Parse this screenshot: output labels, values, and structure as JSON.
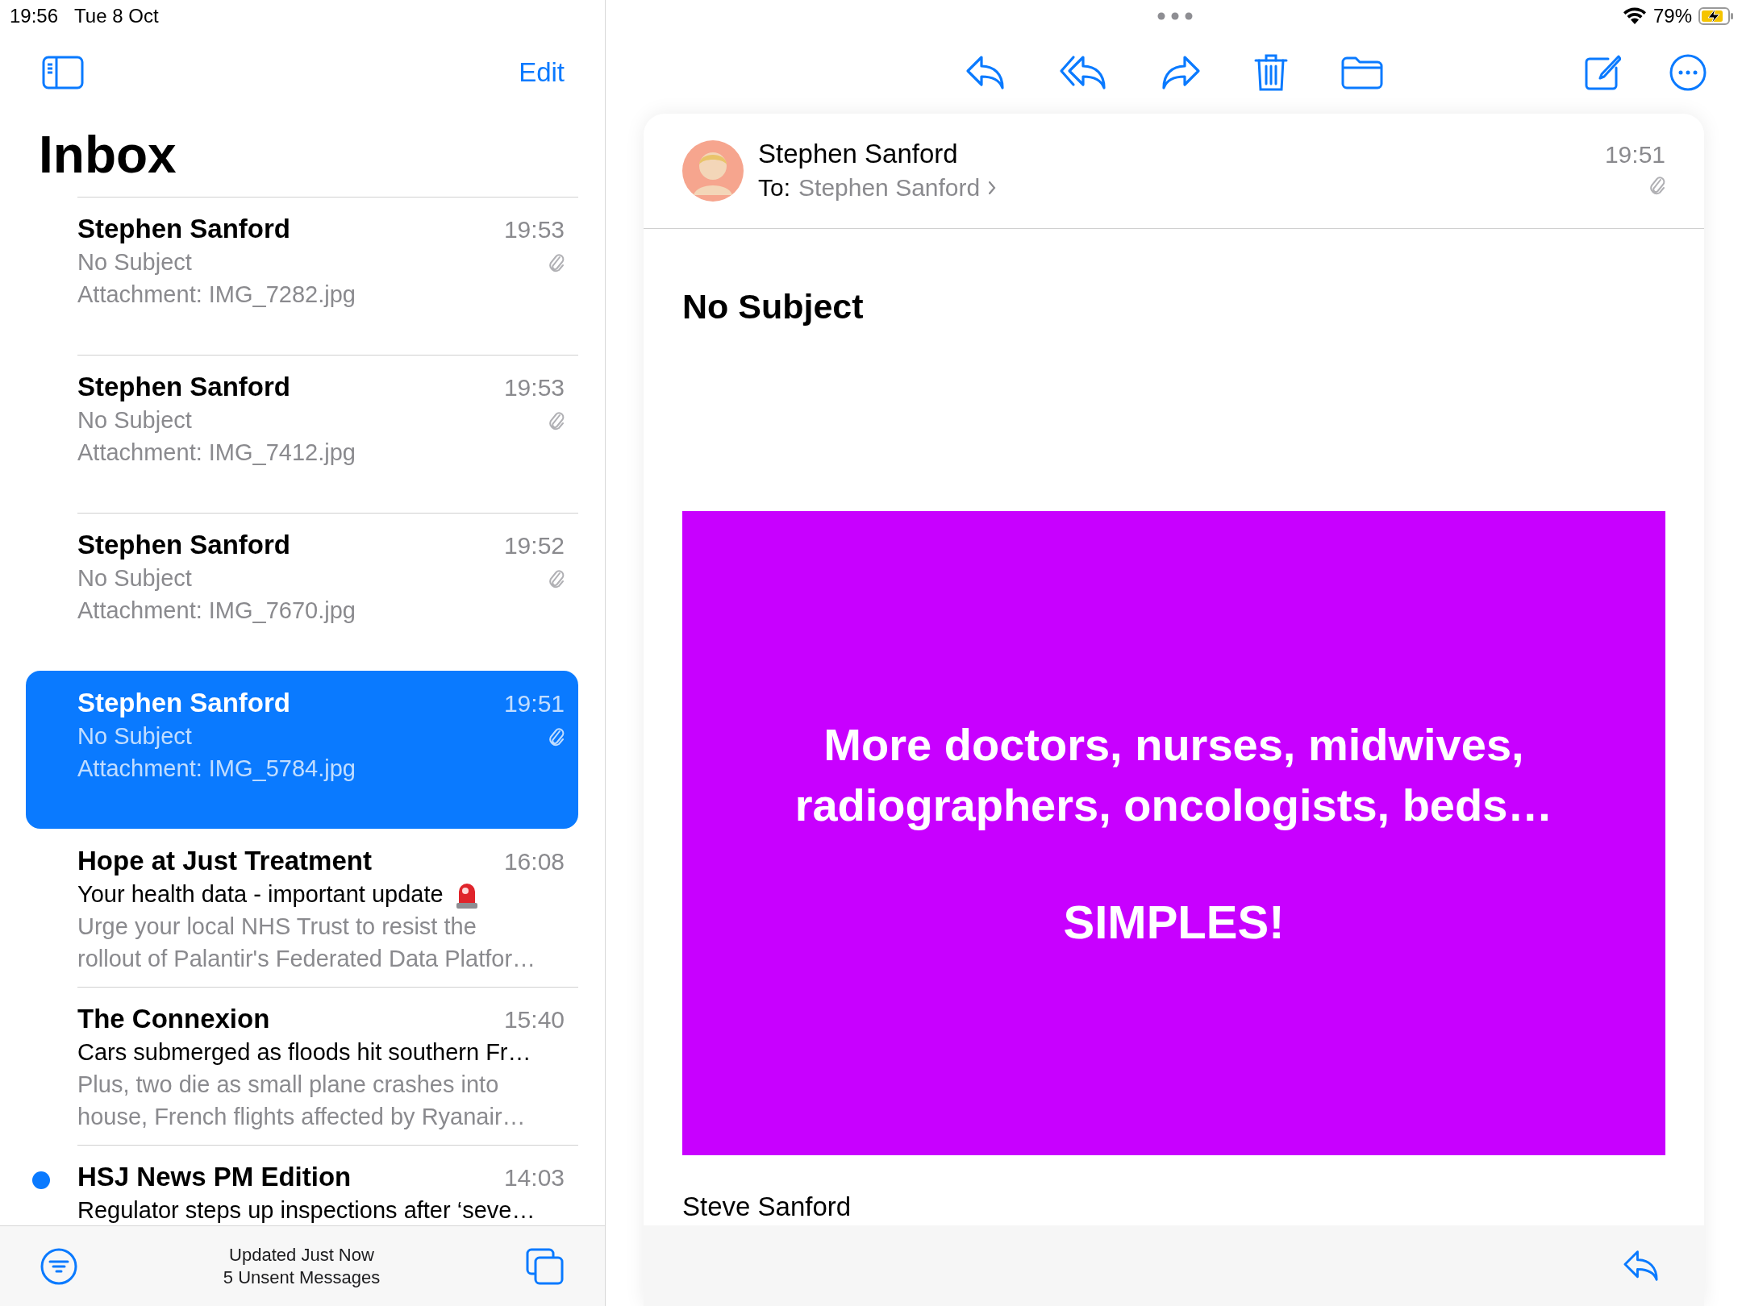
{
  "status_bar": {
    "time": "19:56",
    "date": "Tue 8 Oct",
    "battery": "79%"
  },
  "mailbox": {
    "edit": "Edit",
    "title": "Inbox",
    "emails": [
      {
        "sender": "Stephen Sanford",
        "time": "19:53",
        "subject": "No Subject",
        "preview": [
          "Attachment: IMG_7282.jpg"
        ],
        "siren_icon": false,
        "attachment": true,
        "unread": false,
        "selected": false
      },
      {
        "sender": "Stephen Sanford",
        "time": "19:53",
        "subject": "No Subject",
        "preview": [
          "Attachment: IMG_7412.jpg"
        ],
        "siren_icon": false,
        "attachment": true,
        "unread": false,
        "selected": false
      },
      {
        "sender": "Stephen Sanford",
        "time": "19:52",
        "subject": "No Subject",
        "preview": [
          "Attachment: IMG_7670.jpg"
        ],
        "siren_icon": false,
        "attachment": true,
        "unread": false,
        "selected": false
      },
      {
        "sender": "Stephen Sanford",
        "time": "19:51",
        "subject": "No Subject",
        "preview": [
          "Attachment: IMG_5784.jpg"
        ],
        "siren_icon": false,
        "attachment": true,
        "unread": false,
        "selected": true
      },
      {
        "sender": "Hope at Just Treatment",
        "time": "16:08",
        "subject": "Your health data - important update",
        "siren_icon": true,
        "preview": [
          "Urge your local NHS Trust to resist the",
          "rollout of Palantir's Federated Data Platfor…"
        ],
        "attachment": false,
        "unread": false,
        "selected": false
      },
      {
        "sender": "The Connexion",
        "time": "15:40",
        "subject": "Cars submerged as floods hit southern Fr…",
        "siren_icon": false,
        "preview": [
          "Plus, two die as small plane crashes into",
          "house, French flights affected by Ryanair…"
        ],
        "attachment": false,
        "unread": false,
        "selected": false
      },
      {
        "sender": "HSJ News PM Edition",
        "time": "14:03",
        "subject": "Regulator steps up inspections after ‘seve…",
        "siren_icon": false,
        "attachment": false,
        "unread": true,
        "selected": false
      }
    ],
    "footer": {
      "line1": "Updated Just Now",
      "line2": "5 Unsent Messages"
    }
  },
  "message": {
    "sender": "Stephen Sanford",
    "to_label": "To:",
    "to": "Stephen Sanford",
    "time": "19:51",
    "attachment": true,
    "subject": "No Subject",
    "image": {
      "lines": [
        "More doctors, nurses, midwives,",
        "radiographers, oncologists, beds…"
      ],
      "headline": "SIMPLES!"
    },
    "signature": "Steve Sanford"
  }
}
